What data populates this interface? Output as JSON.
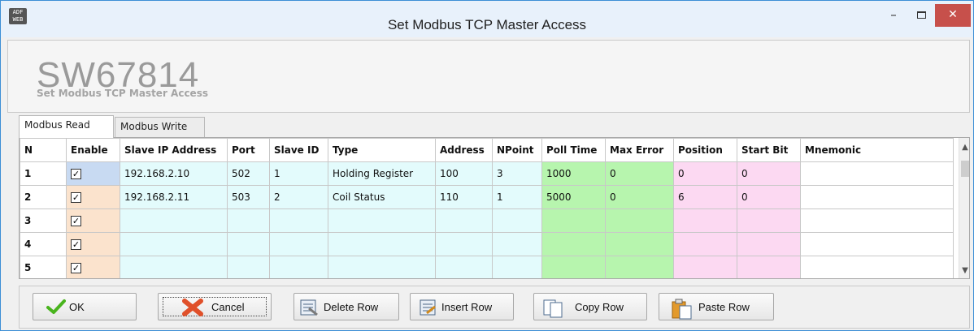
{
  "window": {
    "title": "Set Modbus TCP Master Access",
    "icon_text": "ADF WEB",
    "controls": {
      "minimize": "–",
      "close": "✕"
    }
  },
  "header": {
    "model": "SW67814",
    "subtitle": "Set Modbus TCP Master Access"
  },
  "tabs": [
    {
      "label": "Modbus Read",
      "active": true
    },
    {
      "label": "Modbus Write",
      "active": false
    }
  ],
  "grid": {
    "columns": [
      "N",
      "Enable",
      "Slave IP Address",
      "Port",
      "Slave ID",
      "Type",
      "Address",
      "NPoint",
      "Poll Time",
      "Max Error",
      "Position",
      "Start Bit",
      "Mnemonic"
    ],
    "rows": [
      {
        "n": "1",
        "enable": true,
        "ip": "192.168.2.10",
        "port": "502",
        "slave_id": "1",
        "type": "Holding Register",
        "address": "100",
        "npoint": "3",
        "poll_time": "1000",
        "max_error": "0",
        "position": "0",
        "start_bit": "0",
        "mnemonic": ""
      },
      {
        "n": "2",
        "enable": true,
        "ip": "192.168.2.11",
        "port": "503",
        "slave_id": "2",
        "type": "Coil Status",
        "address": "110",
        "npoint": "1",
        "poll_time": "5000",
        "max_error": "0",
        "position": "6",
        "start_bit": "0",
        "mnemonic": ""
      },
      {
        "n": "3",
        "enable": true,
        "ip": "",
        "port": "",
        "slave_id": "",
        "type": "",
        "address": "",
        "npoint": "",
        "poll_time": "",
        "max_error": "",
        "position": "",
        "start_bit": "",
        "mnemonic": ""
      },
      {
        "n": "4",
        "enable": true,
        "ip": "",
        "port": "",
        "slave_id": "",
        "type": "",
        "address": "",
        "npoint": "",
        "poll_time": "",
        "max_error": "",
        "position": "",
        "start_bit": "",
        "mnemonic": ""
      },
      {
        "n": "5",
        "enable": true,
        "ip": "",
        "port": "",
        "slave_id": "",
        "type": "",
        "address": "",
        "npoint": "",
        "poll_time": "",
        "max_error": "",
        "position": "",
        "start_bit": "",
        "mnemonic": ""
      }
    ],
    "colors": {
      "enable": "#fbe3cd",
      "enable_selected": "#c8daf2",
      "connection": "#e3fbfc",
      "polling": "#b7f5ae",
      "mapping": "#fcd9f2"
    }
  },
  "buttons": {
    "ok": "OK",
    "cancel": "Cancel",
    "delete_row": "Delete Row",
    "insert_row": "Insert Row",
    "copy_row": "Copy Row",
    "paste_row": "Paste Row"
  }
}
